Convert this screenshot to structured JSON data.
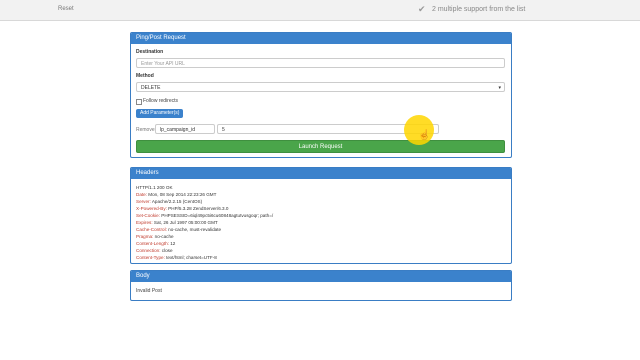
{
  "topbar": {
    "left_text": "Reset",
    "right_text": "2 multiple support from the list"
  },
  "request_panel": {
    "title": "Ping/Post Request",
    "destination_label": "Destination",
    "destination_placeholder": "Enter Your API URL",
    "method_label": "Method",
    "method_value": "DELETE",
    "follow_redirects_label": "Follow redirects",
    "add_parameter_label": "Add Parameter(s)",
    "param_remove_label": "Remove",
    "param_name": "lp_campaign_id",
    "param_value": "5",
    "launch_label": "Launch Request"
  },
  "headers_panel": {
    "title": "Headers",
    "lines": [
      {
        "key": "",
        "value": "HTTP/1.1 200 OK"
      },
      {
        "key": "Date:",
        "value": " Mon, 08 Sep 2014 22:23:26 GMT"
      },
      {
        "key": "Server:",
        "value": " Apache/2.2.15 (CentOS)"
      },
      {
        "key": "X-Powered-By:",
        "value": " PHP/5.3.28 ZendServer/6.3.0"
      },
      {
        "key": "Set-Cookie:",
        "value": " PHPSESSID=6iql49pc5i6cu60848agtutvusgoqr; path=/"
      },
      {
        "key": "Expires:",
        "value": " Sat, 26 Jul 1997 05:00:00 GMT"
      },
      {
        "key": "Cache-Control:",
        "value": " no-cache, must-revalidate"
      },
      {
        "key": "Pragma:",
        "value": " no-cache"
      },
      {
        "key": "Content-Length:",
        "value": " 12"
      },
      {
        "key": "Connection:",
        "value": " close"
      },
      {
        "key": "Content-Type:",
        "value": " text/html; charset=UTF-8"
      }
    ]
  },
  "body_panel": {
    "title": "Body",
    "content": "Invalid Post"
  }
}
